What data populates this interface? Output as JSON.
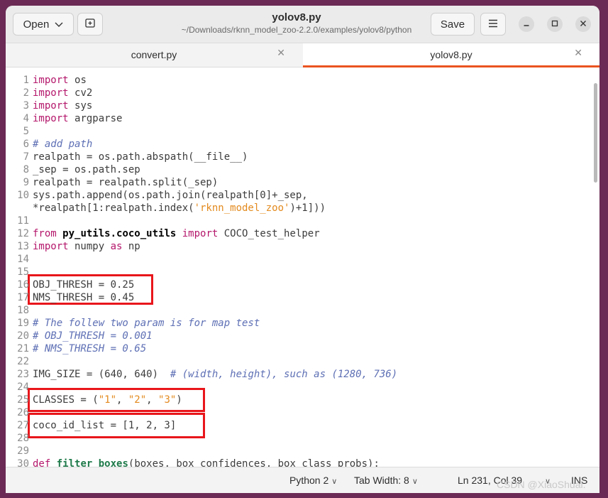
{
  "window": {
    "title": "yolov8.py",
    "subtitle": "~/Downloads/rknn_model_zoo-2.2.0/examples/yolov8/python",
    "open_label": "Open",
    "save_label": "Save"
  },
  "tabs": [
    {
      "label": "convert.py",
      "active": false
    },
    {
      "label": "yolov8.py",
      "active": true
    }
  ],
  "code_lines": [
    {
      "n": "1",
      "segs": [
        [
          "kw",
          "import"
        ],
        [
          "",
          "os"
        ]
      ]
    },
    {
      "n": "2",
      "segs": [
        [
          "kw",
          "import"
        ],
        [
          "",
          "cv2"
        ]
      ]
    },
    {
      "n": "3",
      "segs": [
        [
          "kw",
          "import"
        ],
        [
          "",
          "sys"
        ]
      ]
    },
    {
      "n": "4",
      "segs": [
        [
          "kw",
          "import"
        ],
        [
          "",
          "argparse"
        ]
      ]
    },
    {
      "n": "5",
      "segs": []
    },
    {
      "n": "6",
      "segs": [
        [
          "cm",
          "# add path"
        ]
      ]
    },
    {
      "n": "7",
      "segs": [
        [
          "",
          "realpath = os.path.abspath(__file__)"
        ]
      ]
    },
    {
      "n": "8",
      "segs": [
        [
          "",
          "_sep = os.path.sep"
        ]
      ]
    },
    {
      "n": "9",
      "segs": [
        [
          "",
          "realpath = realpath.split(_sep)"
        ]
      ]
    },
    {
      "n": "10",
      "segs": [
        [
          "",
          "sys.path.append(os.path.join(realpath[0]+_sep,"
        ]
      ]
    },
    {
      "n": "",
      "segs": [
        [
          "",
          "*realpath[1:realpath.index("
        ],
        [
          "st",
          "'rknn_model_zoo'"
        ],
        [
          "",
          ")+1]))"
        ]
      ]
    },
    {
      "n": "11",
      "segs": []
    },
    {
      "n": "12",
      "segs": [
        [
          "kw",
          "from"
        ],
        [
          "",
          " "
        ],
        [
          "mod",
          "py_utils.coco_utils"
        ],
        [
          "",
          " "
        ],
        [
          "kw",
          "import"
        ],
        [
          "",
          " COCO_test_helper"
        ]
      ]
    },
    {
      "n": "13",
      "segs": [
        [
          "kw",
          "import"
        ],
        [
          "",
          " numpy "
        ],
        [
          "kw",
          "as"
        ],
        [
          "",
          " np"
        ]
      ]
    },
    {
      "n": "14",
      "segs": []
    },
    {
      "n": "15",
      "segs": []
    },
    {
      "n": "16",
      "segs": [
        [
          "",
          "OBJ_THRESH = 0.25"
        ]
      ]
    },
    {
      "n": "17",
      "segs": [
        [
          "",
          "NMS_THRESH = 0.45"
        ]
      ]
    },
    {
      "n": "18",
      "segs": []
    },
    {
      "n": "19",
      "segs": [
        [
          "cm",
          "# The follew two param is for map test"
        ]
      ]
    },
    {
      "n": "20",
      "segs": [
        [
          "cm",
          "# OBJ_THRESH = 0.001"
        ]
      ]
    },
    {
      "n": "21",
      "segs": [
        [
          "cm",
          "# NMS_THRESH = 0.65"
        ]
      ]
    },
    {
      "n": "22",
      "segs": []
    },
    {
      "n": "23",
      "segs": [
        [
          "",
          "IMG_SIZE = (640, 640)  "
        ],
        [
          "cm",
          "# (width, height), such as (1280, 736)"
        ]
      ]
    },
    {
      "n": "24",
      "segs": []
    },
    {
      "n": "25",
      "segs": [
        [
          "",
          "CLASSES = ("
        ],
        [
          "st",
          "\"1\""
        ],
        [
          "",
          ", "
        ],
        [
          "st",
          "\"2\""
        ],
        [
          "",
          ", "
        ],
        [
          "st",
          "\"3\""
        ],
        [
          "",
          ")"
        ]
      ]
    },
    {
      "n": "26",
      "segs": []
    },
    {
      "n": "27",
      "segs": [
        [
          "",
          "coco_id_list = [1, 2, 3]"
        ]
      ]
    },
    {
      "n": "28",
      "segs": []
    },
    {
      "n": "29",
      "segs": []
    },
    {
      "n": "30",
      "segs": [
        [
          "kw",
          "def"
        ],
        [
          "",
          " "
        ],
        [
          "fn",
          "filter_boxes"
        ],
        [
          "",
          "(boxes, box_confidences, box_class_probs):"
        ]
      ]
    }
  ],
  "statusbar": {
    "language": "Python 2",
    "tab_width": "Tab Width: 8",
    "position": "Ln 231, Col 39",
    "mode": "INS"
  },
  "watermark": "CSDN @XiaoShuai."
}
